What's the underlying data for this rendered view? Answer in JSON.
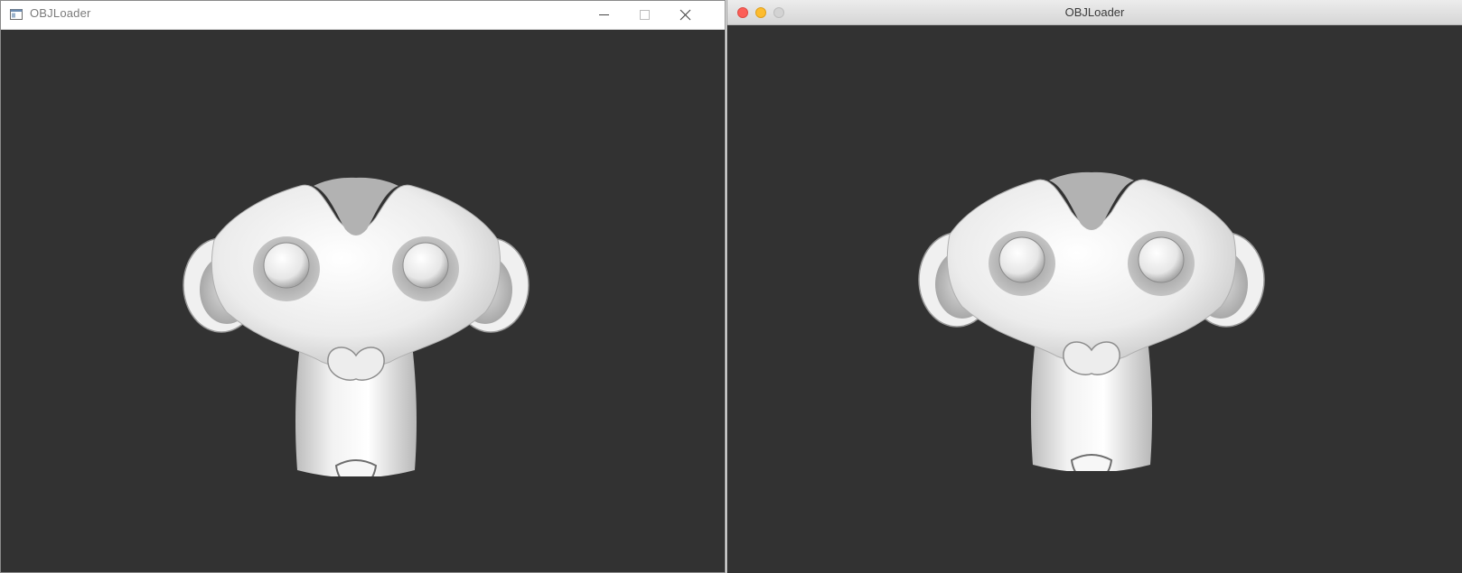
{
  "windows": [
    {
      "id": "left",
      "style": "windows",
      "title": "OBJLoader",
      "caption_buttons": [
        "minimize",
        "maximize",
        "close"
      ],
      "viewport_background": "#323232",
      "model_icon": "monkey-head-model"
    },
    {
      "id": "right",
      "style": "macos",
      "title": "OBJLoader",
      "traffic_lights": [
        "close",
        "minimize",
        "zoom"
      ],
      "viewport_background": "#323232",
      "model_icon": "monkey-head-model"
    }
  ],
  "colors": {
    "viewport": "#323232",
    "model": "#e8e8e8",
    "mac_close": "#fc5e57",
    "mac_minimize": "#fdbc2e",
    "mac_zoom_inactive": "#d3d3d3"
  }
}
